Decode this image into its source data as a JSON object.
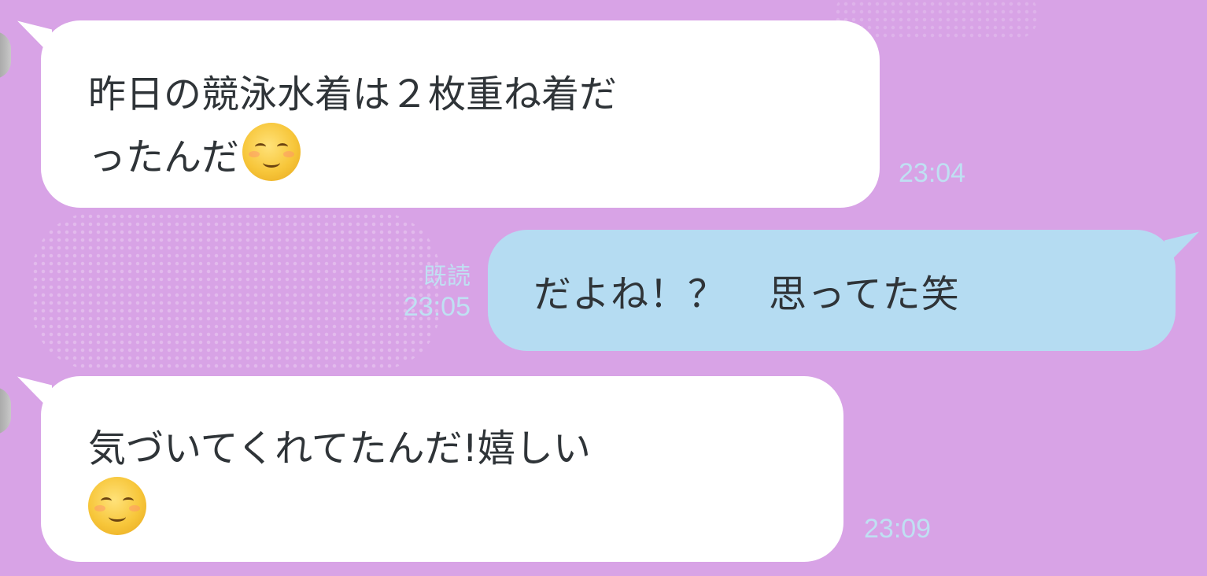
{
  "messages": [
    {
      "direction": "incoming",
      "line1": "昨日の競泳水着は２枚重ね着だ",
      "line2": "ったんだ",
      "emoji": "smiling-face-icon",
      "time": "23:04"
    },
    {
      "direction": "outgoing",
      "part1": "だよね！？",
      "part2": "思ってた笑",
      "read_label": "既読",
      "time": "23:05"
    },
    {
      "direction": "incoming",
      "line1": "気づいてくれてたんだ!嬉しい",
      "emoji": "smiling-face-icon",
      "time": "23:09"
    }
  ],
  "colors": {
    "background": "#d8a3e6",
    "incoming_bubble": "#ffffff",
    "outgoing_bubble": "#b5dcf2",
    "timestamp": "#bfe0f2"
  }
}
